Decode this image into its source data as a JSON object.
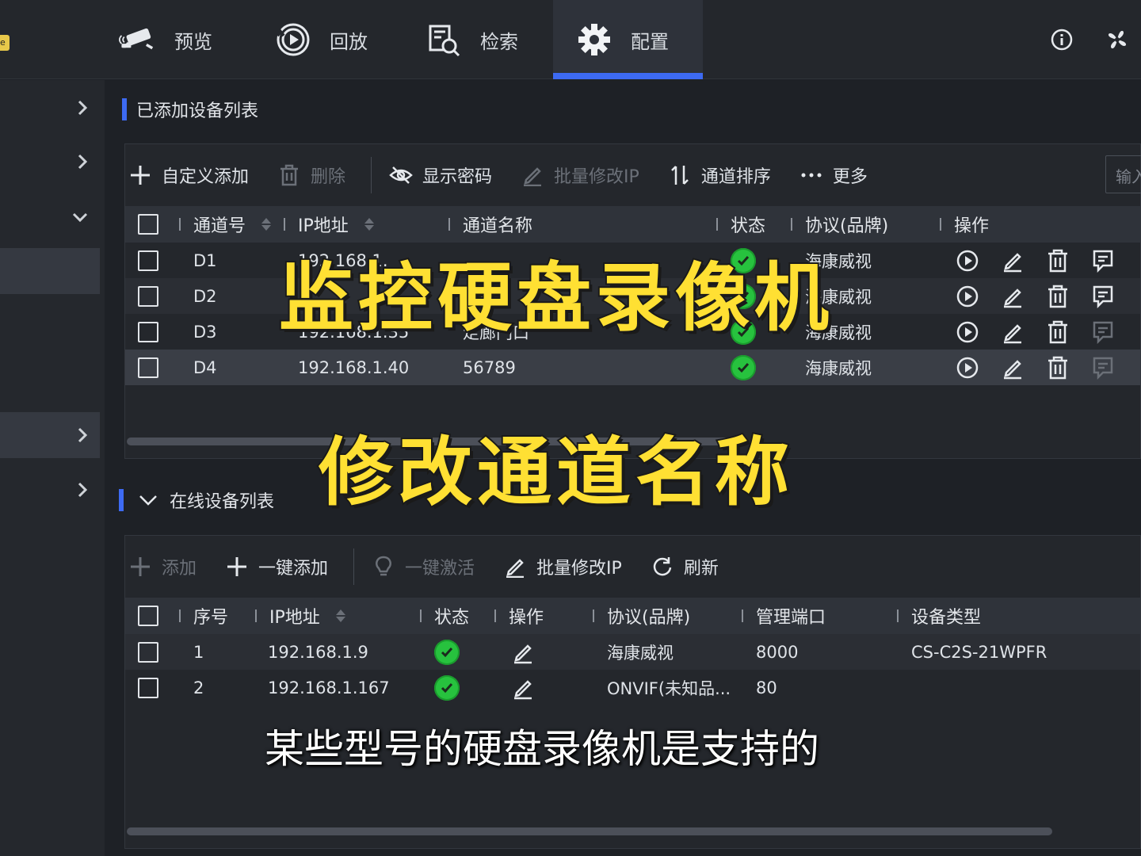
{
  "nav": {
    "badge": "e",
    "tabs": [
      {
        "label": "预览",
        "icon": "camera-icon"
      },
      {
        "label": "回放",
        "icon": "playback-icon"
      },
      {
        "label": "检索",
        "icon": "search-doc-icon"
      },
      {
        "label": "配置",
        "icon": "gear-icon",
        "active": true
      }
    ],
    "right_icons": [
      "info-icon",
      "fan-icon"
    ]
  },
  "sidebar": {
    "rows": [
      {
        "chevron": "right"
      },
      {
        "chevron": "right"
      },
      {
        "chevron": "down"
      },
      {
        "chevron": "none",
        "selected": true
      },
      {
        "chevron": "right",
        "selected": true
      },
      {
        "chevron": "right"
      }
    ]
  },
  "added_devices": {
    "title": "已添加设备列表",
    "toolbar": {
      "custom_add": "自定义添加",
      "delete": "删除",
      "show_password": "显示密码",
      "batch_edit_ip": "批量修改IP",
      "channel_sort": "通道排序",
      "more": "更多",
      "search_placeholder": "输入"
    },
    "columns": {
      "channel_no": "通道号",
      "ip": "IP地址",
      "channel_name": "通道名称",
      "status": "状态",
      "protocol": "协议(品牌)",
      "actions": "操作"
    },
    "rows": [
      {
        "channel": "D1",
        "ip": "192.168.1.",
        "name": "",
        "status": "ok",
        "protocol": "海康威视"
      },
      {
        "channel": "D2",
        "ip": "",
        "name": "门口",
        "status": "ok",
        "protocol": "海康威视"
      },
      {
        "channel": "D3",
        "ip": "192.168.1.35",
        "name": "走廊门口",
        "status": "ok",
        "protocol": "海康威视"
      },
      {
        "channel": "D4",
        "ip": "192.168.1.40",
        "name": "56789",
        "status": "ok",
        "protocol": "海康威视"
      }
    ]
  },
  "online_devices": {
    "title": "在线设备列表",
    "toolbar": {
      "add": "添加",
      "one_click_add": "一键添加",
      "one_click_activate": "一键激活",
      "batch_edit_ip": "批量修改IP",
      "refresh": "刷新"
    },
    "columns": {
      "seq": "序号",
      "ip": "IP地址",
      "status": "状态",
      "actions": "操作",
      "protocol": "协议(品牌)",
      "port": "管理端口",
      "device_type": "设备类型"
    },
    "rows": [
      {
        "seq": "1",
        "ip": "192.168.1.9",
        "status": "ok",
        "protocol": "海康威视",
        "port": "8000",
        "type": "CS-C2S-21WPFR"
      },
      {
        "seq": "2",
        "ip": "192.168.1.167",
        "status": "ok",
        "protocol": "ONVIF(未知品...",
        "port": "80",
        "type": ""
      }
    ]
  },
  "overlay": {
    "title_line1": "监控硬盘录像机",
    "title_line2": "修改通道名称",
    "subtitle": "某些型号的硬盘录像机是支持的",
    "title_color": "#ffe033"
  },
  "colors": {
    "accent": "#3d6af2",
    "status_ok": "#27c23e"
  }
}
